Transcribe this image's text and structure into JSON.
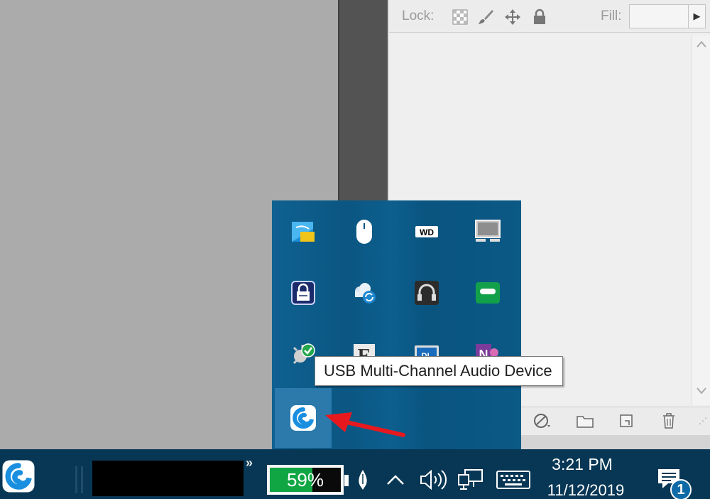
{
  "layers_panel": {
    "lock_label": "Lock:",
    "fill_label": "Fill:",
    "fill_value": ""
  },
  "tray_flyout": {
    "icons": [
      {
        "name": "intel-graphics-icon"
      },
      {
        "name": "mouse-icon"
      },
      {
        "name": "wd-drive-icon"
      },
      {
        "name": "display-monitor-icon"
      },
      {
        "name": "vpn-lock-icon"
      },
      {
        "name": "cloud-sync-icon"
      },
      {
        "name": "headphones-icon"
      },
      {
        "name": "tape-recorder-icon"
      },
      {
        "name": "shield-check-icon"
      },
      {
        "name": "e-app-icon"
      },
      {
        "name": "dl-app-icon"
      },
      {
        "name": "onenote-icon"
      },
      {
        "name": "swirl-app-icon"
      }
    ],
    "wd_label": "WD",
    "dl_label": "DL",
    "e_label": "E",
    "n_label": "N"
  },
  "tooltip": {
    "text": "USB Multi-Channel Audio Device"
  },
  "taskbar": {
    "overflow_chevrons": "»",
    "battery_percent": "59%",
    "battery_level": 0.59,
    "caret_up": "^",
    "clock_time": "3:21 PM",
    "clock_date": "11/12/2019",
    "notification_count": "1"
  },
  "colors": {
    "taskbar_bg": "#073755",
    "flyout_bg": "#0e5b86",
    "battery_green": "#10a644",
    "arrow_red": "#e8191e"
  }
}
